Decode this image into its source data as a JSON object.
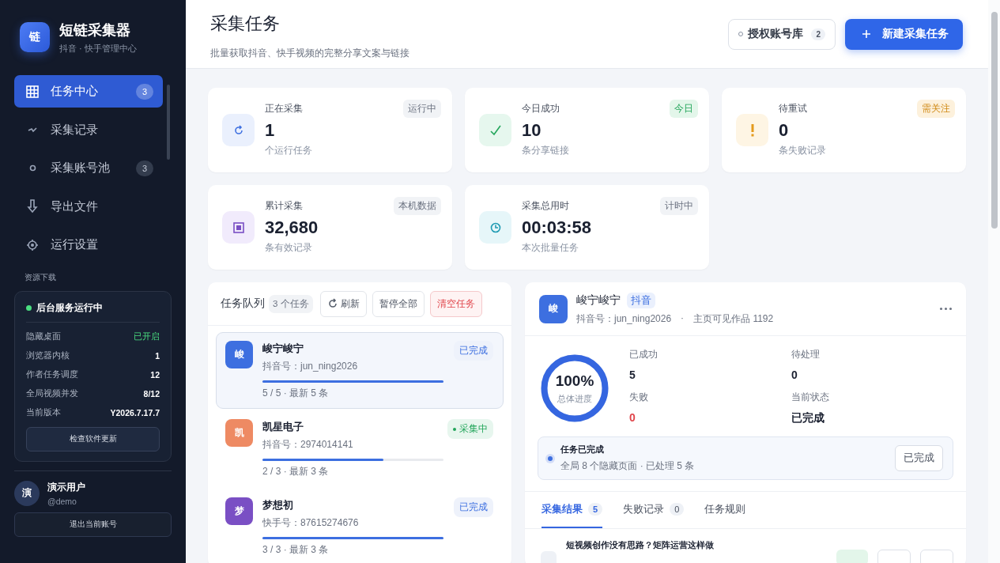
{
  "sidebar": {
    "logo": "链",
    "title": "短链采集器",
    "subtitle": "抖音 · 快手管理中心",
    "nav": [
      {
        "label": "任务中心",
        "badge": "3",
        "selected": true
      },
      {
        "label": "采集记录",
        "selected": false
      },
      {
        "label": "采集账号池",
        "badge": "3",
        "selected": false
      },
      {
        "label": "导出文件",
        "selected": false
      },
      {
        "label": "运行设置",
        "selected": false
      }
    ],
    "section_label": "资源下载",
    "service": {
      "title": "后台服务运行中",
      "running": true,
      "rows": [
        {
          "label": "隐藏桌面",
          "value": "已开启",
          "kind": "positive"
        },
        {
          "label": "浏览器内核",
          "value": "1",
          "kind": "plain"
        },
        {
          "label": "作者任务调度",
          "value": "12",
          "kind": "plain"
        },
        {
          "label": "全局视频并发",
          "value": "8/12",
          "kind": "plain"
        },
        {
          "label": "当前版本",
          "value": "Y2026.7.17.7",
          "kind": "plain"
        }
      ],
      "button": "检查软件更新"
    },
    "user": {
      "avatar": "演",
      "name": "演示用户",
      "handle": "@demo",
      "logout": "退出当前账号"
    }
  },
  "header": {
    "title": "采集任务",
    "subtitle": "批量获取抖音、快手视频的完整分享文案与链接",
    "accounts_button": {
      "label": "授权账号库",
      "count": "2"
    },
    "new_button": "新建采集任务"
  },
  "stats": [
    {
      "label": "正在采集",
      "value": "1",
      "unit": "个运行任务",
      "tag": "运行中"
    },
    {
      "label": "今日成功",
      "value": "10",
      "unit": "条分享链接",
      "tag": "今日"
    },
    {
      "label": "待重试",
      "value": "0",
      "unit": "条失败记录",
      "tag": "需关注"
    },
    {
      "label": "累计采集",
      "value": "32,680",
      "unit": "条有效记录",
      "tag": "本机数据"
    },
    {
      "label": "采集总用时",
      "value": "00:03:58",
      "unit": "本次批量任务",
      "tag": "计时中"
    }
  ],
  "queue": {
    "title": "任务队列",
    "count": "3 个任务",
    "buttons": [
      {
        "label": "刷新",
        "kind": "refresh"
      },
      {
        "label": "暂停全部",
        "kind": "plain"
      },
      {
        "label": "清空任务",
        "kind": "danger"
      }
    ],
    "tasks": [
      {
        "avatar": "峻",
        "color": "#3d6fe0",
        "name": "峻宁峻宁",
        "account": "抖音号：jun_ning2026",
        "level": 1,
        "progress": "5 / 5 · 最新 5 条",
        "status": "已完成",
        "kind": "done",
        "selected": true
      },
      {
        "avatar": "凯",
        "color": "#ee8a63",
        "name": "凯星电子",
        "account": "抖音号：2974014141",
        "level": 0.67,
        "progress": "2 / 3 · 最新 3 条",
        "status": "采集中",
        "kind": "running",
        "selected": false
      },
      {
        "avatar": "梦",
        "color": "#7a4fc4",
        "name": "梦想初",
        "account": "快手号：87615274676",
        "level": 1,
        "progress": "3 / 3 · 最新 3 条",
        "status": "已完成",
        "kind": "done",
        "selected": false
      }
    ]
  },
  "detail": {
    "avatar": "峻",
    "name": "峻宁峻宁",
    "platform": "抖音",
    "account": "抖音号：jun_ning2026",
    "separator": "·",
    "works": "主页可见作品 1192",
    "ring": {
      "level": 1,
      "value": "100%",
      "label": "总体进度"
    },
    "metrics": [
      {
        "label": "已成功",
        "value": "5",
        "kind": "plain"
      },
      {
        "label": "待处理",
        "value": "0",
        "kind": "plain"
      },
      {
        "label": "失败",
        "value": "0",
        "kind": "danger"
      },
      {
        "label": "当前状态",
        "value": "已完成",
        "kind": "plain"
      }
    ],
    "notice": {
      "title": "任务已完成",
      "text": "全局 8 个隐藏页面 · 已处理 5 条",
      "button": "已完成"
    },
    "tabs": [
      {
        "label": "采集结果",
        "count": "5",
        "selected": true
      },
      {
        "label": "失败记录",
        "count": "0",
        "selected": false
      },
      {
        "label": "任务规则",
        "selected": false
      }
    ],
    "results": [
      {
        "title": "短视频创作没有思路？矩阵运营这样做"
      }
    ]
  }
}
